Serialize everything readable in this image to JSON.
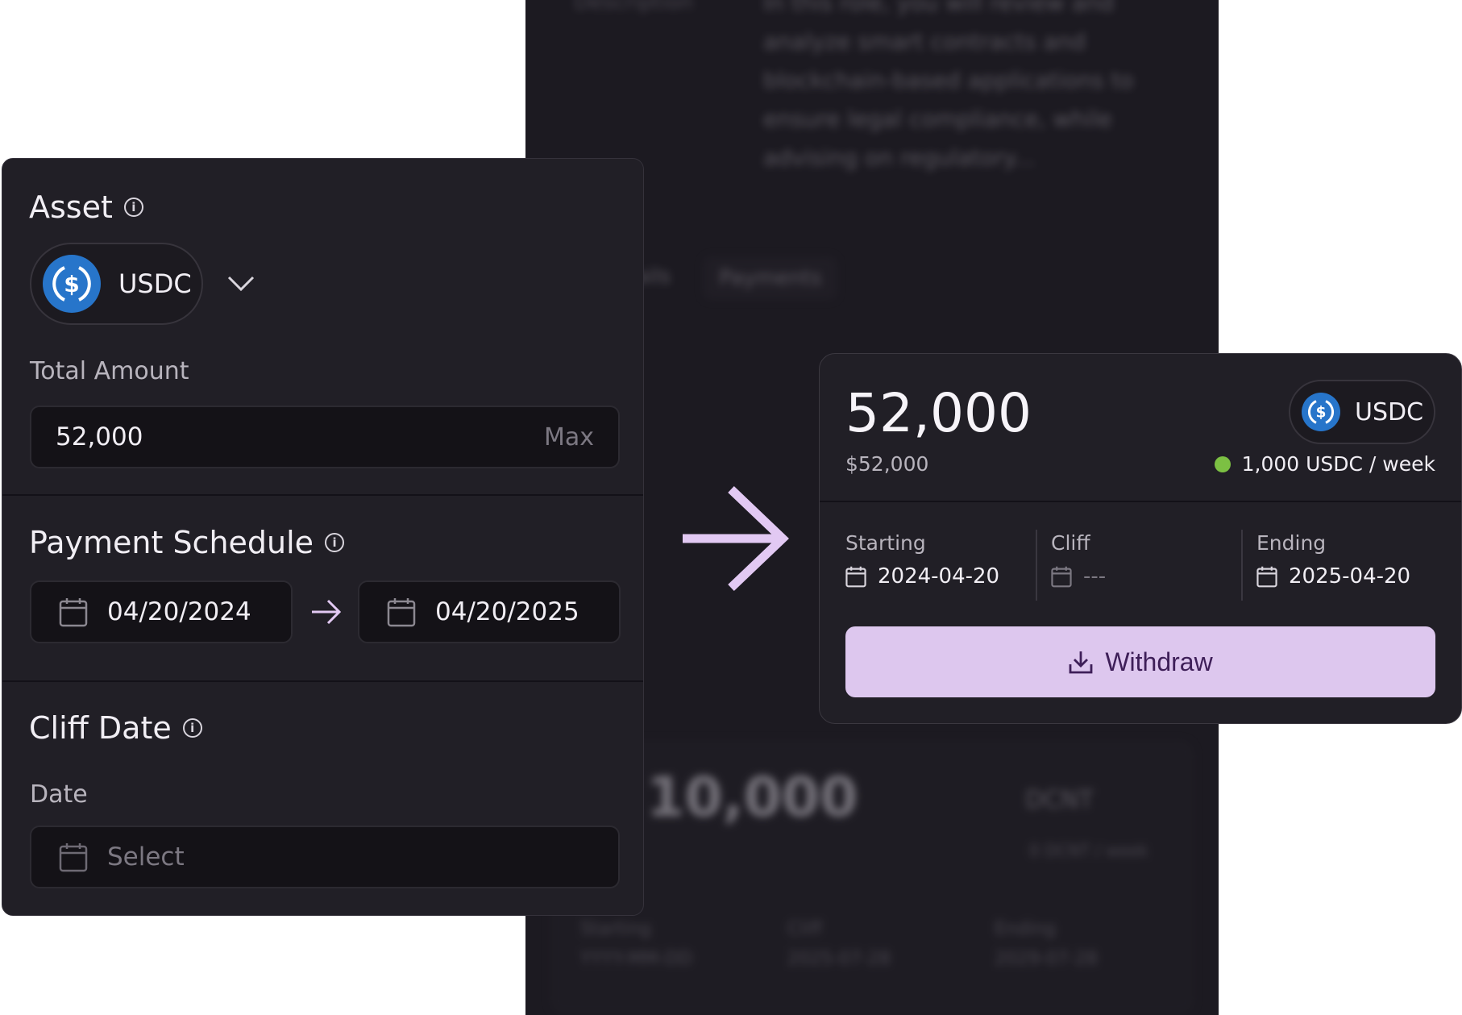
{
  "background": {
    "description_label": "Description",
    "description_text": "In this role, you will review and analyze smart contracts and blockchain-based applications to ensure legal compliance, while advising on regulatory...",
    "tab_inactive": "Details",
    "tab_active": "Payments",
    "amount": "10,000",
    "token": "DCNT",
    "rate": "0 DCNT / week",
    "starting_label": "Starting",
    "starting_value": "YYYY-MM-DD",
    "cliff_label": "Cliff",
    "cliff_value": "2025-07-28",
    "ending_label": "Ending",
    "ending_value": "2029-07-28"
  },
  "form": {
    "asset": {
      "title": "Asset",
      "selected": "USDC",
      "icon": "usdc-icon"
    },
    "total_amount": {
      "label": "Total Amount",
      "value": "52,000",
      "max_label": "Max"
    },
    "payment_schedule": {
      "title": "Payment Schedule",
      "start_date": "04/20/2024",
      "end_date": "04/20/2025"
    },
    "cliff_date": {
      "title": "Cliff Date",
      "date_label": "Date",
      "placeholder": "Select"
    }
  },
  "stream": {
    "amount": "52,000",
    "fiat_value": "$52,000",
    "token": "USDC",
    "rate": "1,000 USDC / week",
    "status_color": "#7cc043",
    "starting_label": "Starting",
    "starting_value": "2024-04-20",
    "cliff_label": "Cliff",
    "cliff_value": "---",
    "ending_label": "Ending",
    "ending_value": "2025-04-20",
    "withdraw_label": "Withdraw"
  },
  "colors": {
    "accent": "#ddc7ee",
    "arrow": "#e2c9f3",
    "usdc_blue": "#2775ca",
    "card_bg": "#211f26"
  }
}
